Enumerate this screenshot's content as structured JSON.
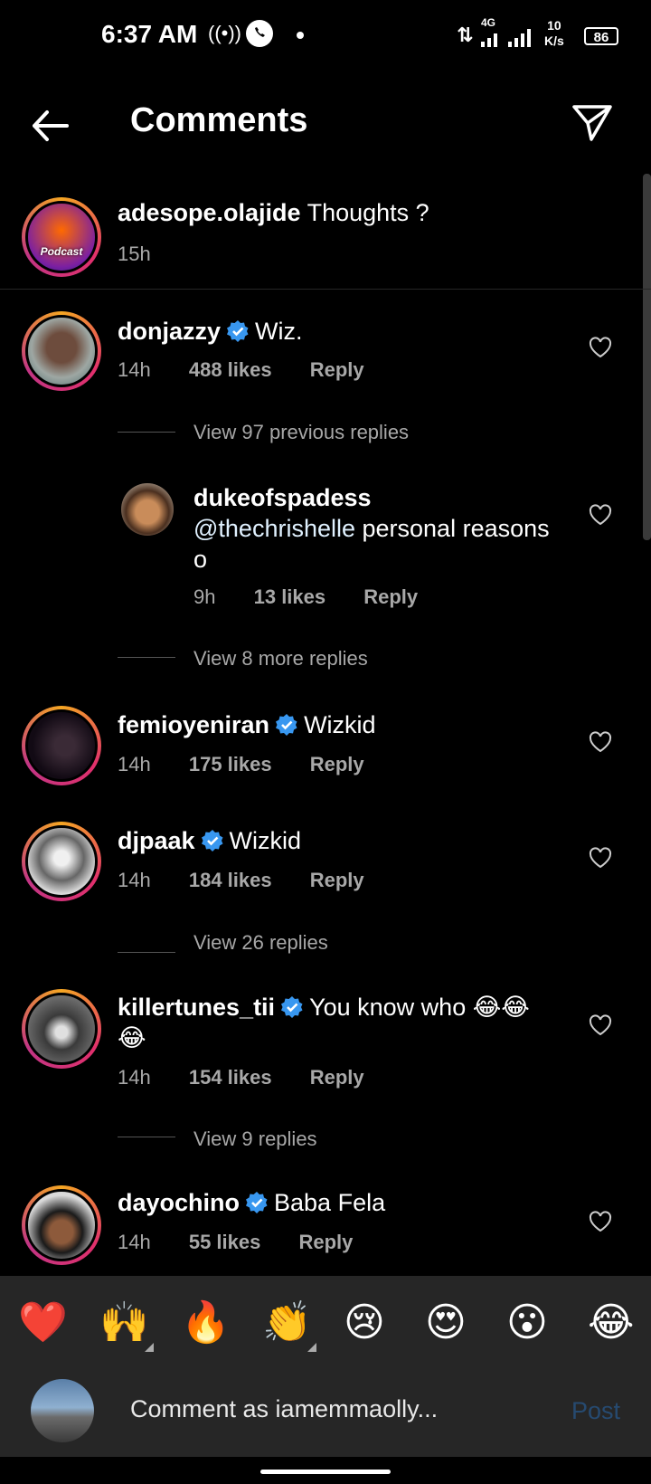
{
  "status_bar": {
    "time": "6:37 AM",
    "network": "4G",
    "speed_value": "10",
    "speed_unit": "K/s",
    "battery": "86"
  },
  "header": {
    "title": "Comments"
  },
  "caption": {
    "username": "adesope.olajide",
    "text": "Thoughts ?",
    "time": "15h",
    "avatar_text": "Podcast"
  },
  "comments": [
    {
      "username": "donjazzy",
      "verified": true,
      "text": "Wiz.",
      "time": "14h",
      "likes": "488 likes",
      "reply": "Reply",
      "view_replies": "View 97 previous replies"
    },
    {
      "username": "femioyeniran",
      "verified": true,
      "text": "Wizkid",
      "time": "14h",
      "likes": "175 likes",
      "reply": "Reply"
    },
    {
      "username": "djpaak",
      "verified": true,
      "text": "Wizkid",
      "time": "14h",
      "likes": "184 likes",
      "reply": "Reply",
      "view_replies": "View 26 replies"
    },
    {
      "username": "killertunes_tii",
      "verified": true,
      "text": "You know who 😂😂",
      "text_line2": "😂",
      "time": "14h",
      "likes": "154 likes",
      "reply": "Reply",
      "view_replies": "View 9 replies"
    },
    {
      "username": "dayochino",
      "verified": true,
      "text": "Baba Fela",
      "time": "14h",
      "likes": "55 likes",
      "reply": "Reply"
    }
  ],
  "reply": {
    "username": "dukeofspadess",
    "mention": "@thechrishelle",
    "text": " personal reasons",
    "text_line2": "o",
    "time": "9h",
    "likes": "13 likes",
    "reply": "Reply",
    "view_more": "View 8 more replies"
  },
  "emoji_bar": [
    "❤️",
    "🙌",
    "🔥",
    "👏",
    "😢",
    "😍",
    "😮",
    "😂"
  ],
  "comment_input": {
    "placeholder": "Comment as iamemmaolly...",
    "post_label": "Post"
  },
  "colors": {
    "background": "#000000",
    "muted_text": "#a8a8a8",
    "verified_blue": "#3897f0",
    "post_disabled": "#264a70",
    "bar_background": "#262626"
  }
}
